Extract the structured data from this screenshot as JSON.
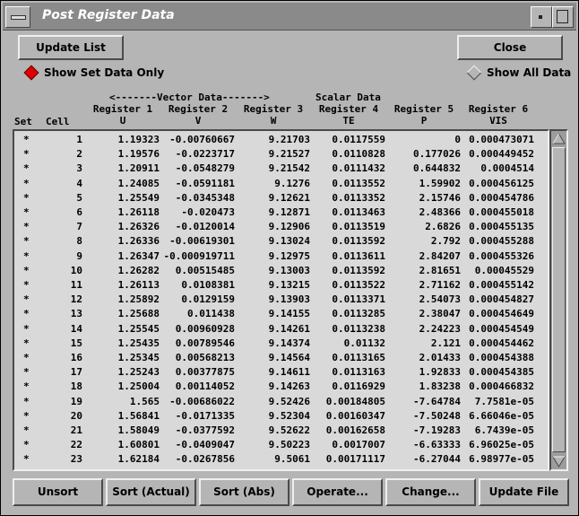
{
  "window": {
    "title": "Post Register Data"
  },
  "buttons": {
    "update_list": "Update List",
    "close": "Close"
  },
  "radios": {
    "set_only": "Show Set Data Only",
    "all": "Show All Data",
    "set_only_selected": true,
    "accent_color": "#e00000"
  },
  "headers": {
    "vector_group": "<-------Vector Data------->",
    "scalar_group": "Scalar Data",
    "set": "Set",
    "cell": "Cell",
    "reg1": "Register 1",
    "reg1_sub": "U",
    "reg2": "Register 2",
    "reg2_sub": "V",
    "reg3": "Register 3",
    "reg3_sub": "W",
    "reg4": "Register 4",
    "reg4_sub": "TE",
    "reg5": "Register 5",
    "reg5_sub": "P",
    "reg6": "Register 6",
    "reg6_sub": "VIS"
  },
  "rows": [
    [
      "*",
      "1",
      "1.19323",
      "-0.00760667",
      "9.21703",
      "0.0117559",
      "0",
      "0.000473071"
    ],
    [
      "*",
      "2",
      "1.19576",
      "-0.0223717",
      "9.21527",
      "0.0110828",
      "0.177026",
      "0.000449452"
    ],
    [
      "*",
      "3",
      "1.20911",
      "-0.0548279",
      "9.21542",
      "0.0111432",
      "0.644832",
      "0.0004514"
    ],
    [
      "*",
      "4",
      "1.24085",
      "-0.0591181",
      "9.1276",
      "0.0113552",
      "1.59902",
      "0.000456125"
    ],
    [
      "*",
      "5",
      "1.25549",
      "-0.0345348",
      "9.12621",
      "0.0113352",
      "2.15746",
      "0.000454786"
    ],
    [
      "*",
      "6",
      "1.26118",
      "-0.020473",
      "9.12871",
      "0.0113463",
      "2.48366",
      "0.000455018"
    ],
    [
      "*",
      "7",
      "1.26326",
      "-0.0120014",
      "9.12906",
      "0.0113519",
      "2.6826",
      "0.000455135"
    ],
    [
      "*",
      "8",
      "1.26336",
      "-0.00619301",
      "9.13024",
      "0.0113592",
      "2.792",
      "0.000455288"
    ],
    [
      "*",
      "9",
      "1.26347",
      "-0.000919711",
      "9.12975",
      "0.0113611",
      "2.84207",
      "0.000455326"
    ],
    [
      "*",
      "10",
      "1.26282",
      "0.00515485",
      "9.13003",
      "0.0113592",
      "2.81651",
      "0.00045529"
    ],
    [
      "*",
      "11",
      "1.26113",
      "0.0108381",
      "9.13215",
      "0.0113522",
      "2.71162",
      "0.000455142"
    ],
    [
      "*",
      "12",
      "1.25892",
      "0.0129159",
      "9.13903",
      "0.0113371",
      "2.54073",
      "0.000454827"
    ],
    [
      "*",
      "13",
      "1.25688",
      "0.011438",
      "9.14155",
      "0.0113285",
      "2.38047",
      "0.000454649"
    ],
    [
      "*",
      "14",
      "1.25545",
      "0.00960928",
      "9.14261",
      "0.0113238",
      "2.24223",
      "0.000454549"
    ],
    [
      "*",
      "15",
      "1.25435",
      "0.00789546",
      "9.14374",
      "0.01132",
      "2.121",
      "0.000454462"
    ],
    [
      "*",
      "16",
      "1.25345",
      "0.00568213",
      "9.14564",
      "0.0113165",
      "2.01433",
      "0.000454388"
    ],
    [
      "*",
      "17",
      "1.25243",
      "0.00377875",
      "9.14611",
      "0.0113163",
      "1.92833",
      "0.000454385"
    ],
    [
      "*",
      "18",
      "1.25004",
      "0.00114052",
      "9.14263",
      "0.0116929",
      "1.83238",
      "0.000466832"
    ],
    [
      "*",
      "19",
      "1.565",
      "-0.00686022",
      "9.52426",
      "0.00184805",
      "-7.64784",
      "7.7581e-05"
    ],
    [
      "*",
      "20",
      "1.56841",
      "-0.0171335",
      "9.52304",
      "0.00160347",
      "-7.50248",
      "6.66046e-05"
    ],
    [
      "*",
      "21",
      "1.58049",
      "-0.0377592",
      "9.52622",
      "0.00162658",
      "-7.19283",
      "6.7439e-05"
    ],
    [
      "*",
      "22",
      "1.60801",
      "-0.0409047",
      "9.50223",
      "0.0017007",
      "-6.63333",
      "6.96025e-05"
    ],
    [
      "*",
      "23",
      "1.62184",
      "-0.0267856",
      "9.5061",
      "0.00171117",
      "-6.27044",
      "6.98977e-05"
    ]
  ],
  "bottom_buttons": [
    "Unsort",
    "Sort (Actual)",
    "Sort (Abs)",
    "Operate...",
    "Change...",
    "Update File"
  ],
  "icons": {
    "menu": "window-menu-icon",
    "min": "minimize-icon",
    "max": "maximize-icon",
    "up": "scroll-up-arrow-icon",
    "down": "scroll-down-arrow-icon"
  }
}
